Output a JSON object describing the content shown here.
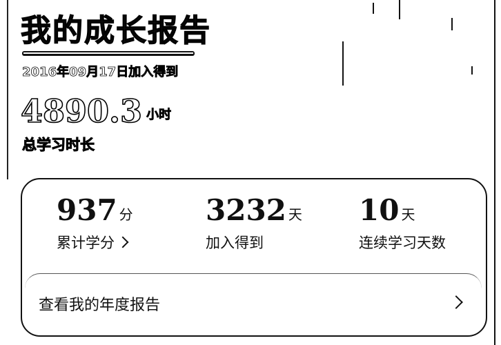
{
  "header": {
    "title": "我的成长报告",
    "join_date": "2016年09月17日加入得到"
  },
  "summary": {
    "total_hours": "4890.3",
    "hours_unit": "小时",
    "total_label": "总学习时长"
  },
  "stats": [
    {
      "value": "937",
      "unit": "分",
      "label": "累计学分"
    },
    {
      "value": "3232",
      "unit": "天",
      "label": "加入得到"
    },
    {
      "value": "10",
      "unit": "天",
      "label": "连续学习天数"
    }
  ],
  "annual_report": {
    "label": "查看我的年度报告"
  },
  "icons": {
    "credits_chevron": "chevron-right-icon",
    "report_chevron": "chevron-right-icon"
  }
}
